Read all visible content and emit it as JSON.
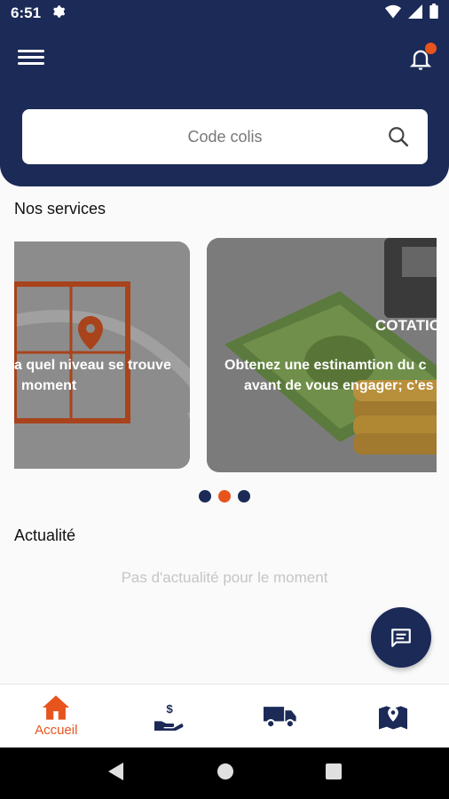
{
  "status_bar": {
    "time": "6:51"
  },
  "search": {
    "placeholder": "Code colis"
  },
  "services": {
    "title": "Nos services",
    "card1_line1": "a quel niveau se trouve",
    "card1_line2": "moment",
    "card2_title": "COTATIO",
    "card2_line1": "Obtenez une estinamtion du c",
    "card2_line2": "avant de vous engager; c'es"
  },
  "carousel": {
    "active_index": 1,
    "count": 3
  },
  "news": {
    "title": "Actualité",
    "empty": "Pas d'actualité pour le moment"
  },
  "bottom_nav": {
    "home_label": "Accueil"
  },
  "colors": {
    "primary": "#1b2a57",
    "accent": "#e8541e"
  }
}
